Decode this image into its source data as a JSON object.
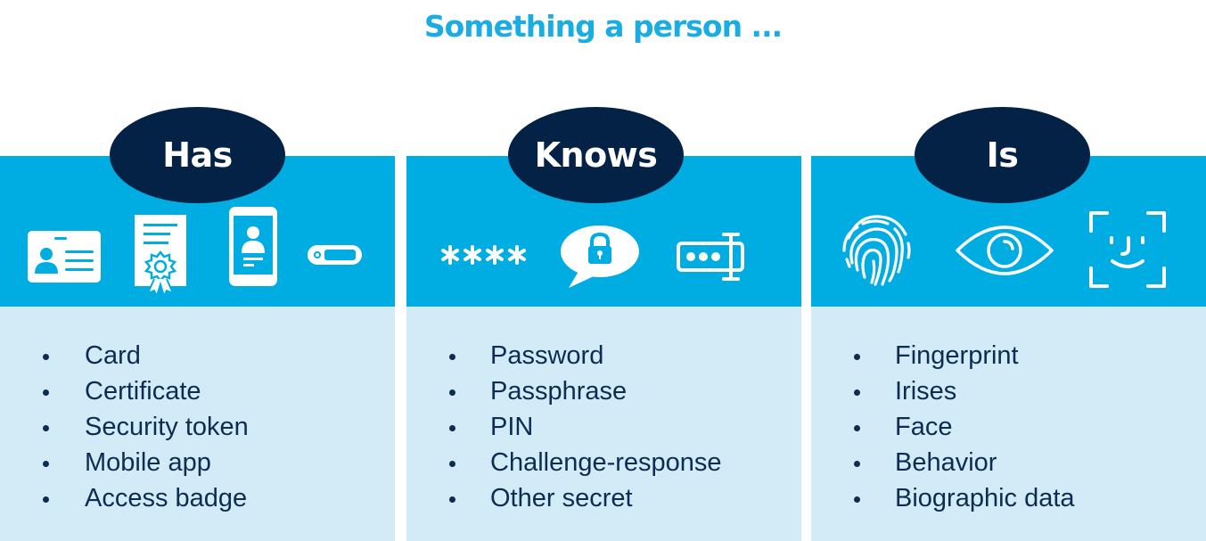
{
  "title": "Something a person ...",
  "colors": {
    "title": "#1aade3",
    "band": "#00ade3",
    "oval": "#032245",
    "panel": "#d3ebf7",
    "text": "#0d2c52",
    "icon": "#ffffff"
  },
  "columns": [
    {
      "heading": "Has",
      "icons": [
        "id-card-icon",
        "certificate-icon",
        "mobile-phone-icon",
        "security-token-icon"
      ],
      "items": [
        "Card",
        "Certificate",
        "Security token",
        "Mobile app",
        "Access badge"
      ]
    },
    {
      "heading": "Knows",
      "icons": [
        "password-asterisks-icon",
        "lock-speech-bubble-icon",
        "password-field-icon"
      ],
      "asterisks": "****",
      "items": [
        "Password",
        "Passphrase",
        "PIN",
        "Challenge-response",
        "Other secret"
      ]
    },
    {
      "heading": "Is",
      "icons": [
        "fingerprint-icon",
        "eye-icon",
        "face-scan-icon"
      ],
      "items": [
        "Fingerprint",
        "Irises",
        "Face",
        "Behavior",
        "Biographic data"
      ]
    }
  ]
}
